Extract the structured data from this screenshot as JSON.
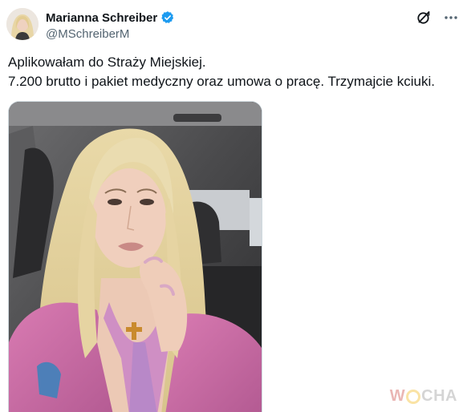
{
  "author": {
    "display_name": "Marianna Schreiber",
    "handle": "@MSchreiberM",
    "verified": true
  },
  "tweet": {
    "lines": [
      "Aplikowałam do Straży Miejskiej.",
      "7.200 brutto i pakiet medyczny oraz umowa o pracę. Trzymajcie kciuki."
    ]
  },
  "actions": {
    "grok_icon": "grok-icon",
    "more_icon": "more-icon"
  },
  "media": {
    "type": "photo"
  },
  "watermark": {
    "first": "W",
    "rest": "CHA"
  },
  "colors": {
    "verified_blue": "#1d9bf0",
    "text_primary": "#0f1419",
    "text_secondary": "#536471",
    "watermark_red": "#c4302b",
    "watermark_yellow": "#f1b200"
  }
}
